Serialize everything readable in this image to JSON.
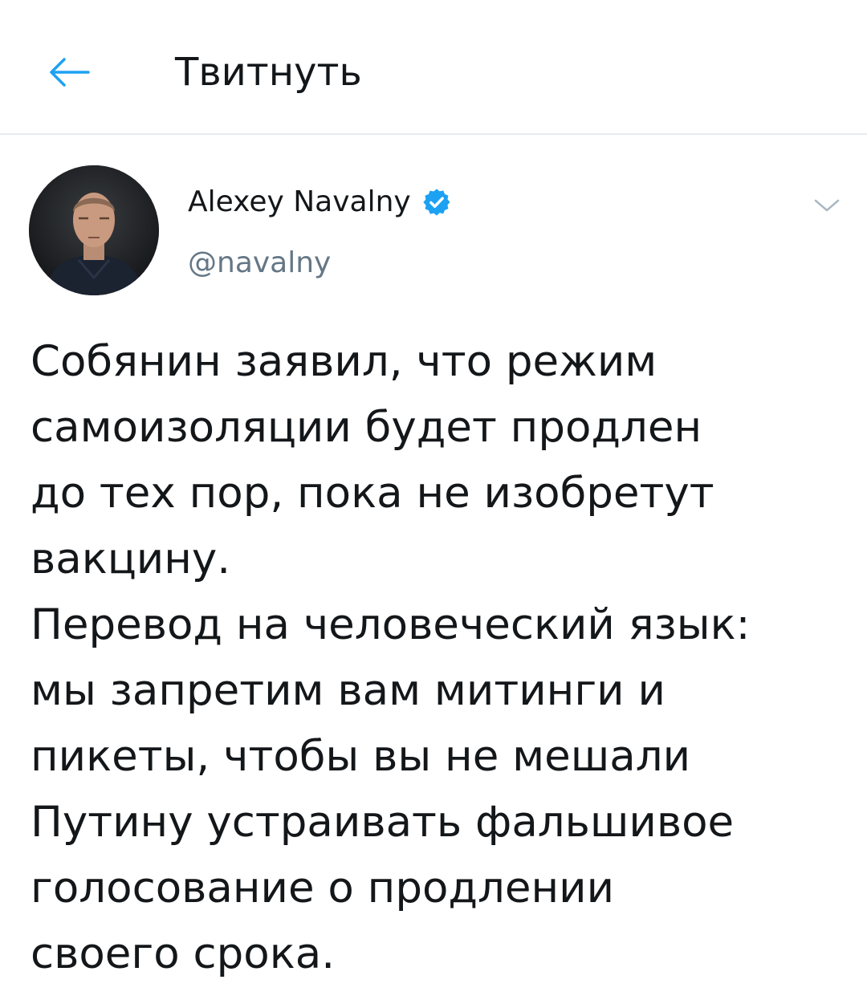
{
  "header": {
    "title": "Твитнуть",
    "back_icon": "arrow-left-icon",
    "accent_color": "#1da1f2"
  },
  "tweet": {
    "author": {
      "display_name": "Alexey Navalny",
      "handle": "@navalny",
      "verified": true,
      "verified_icon": "verified-badge-icon"
    },
    "menu_icon": "chevron-down-icon",
    "text_lines": [
      "Собянин заявил, что режим",
      "самоизоляции будет продлен",
      "до тех пор, пока не изобретут",
      "вакцину.",
      "Перевод на человеческий язык:",
      "мы запретим вам митинги и",
      "пикеты, чтобы вы не мешали",
      "Путину устраивать фальшивое",
      "голосование о продлении",
      "своего срока."
    ]
  }
}
